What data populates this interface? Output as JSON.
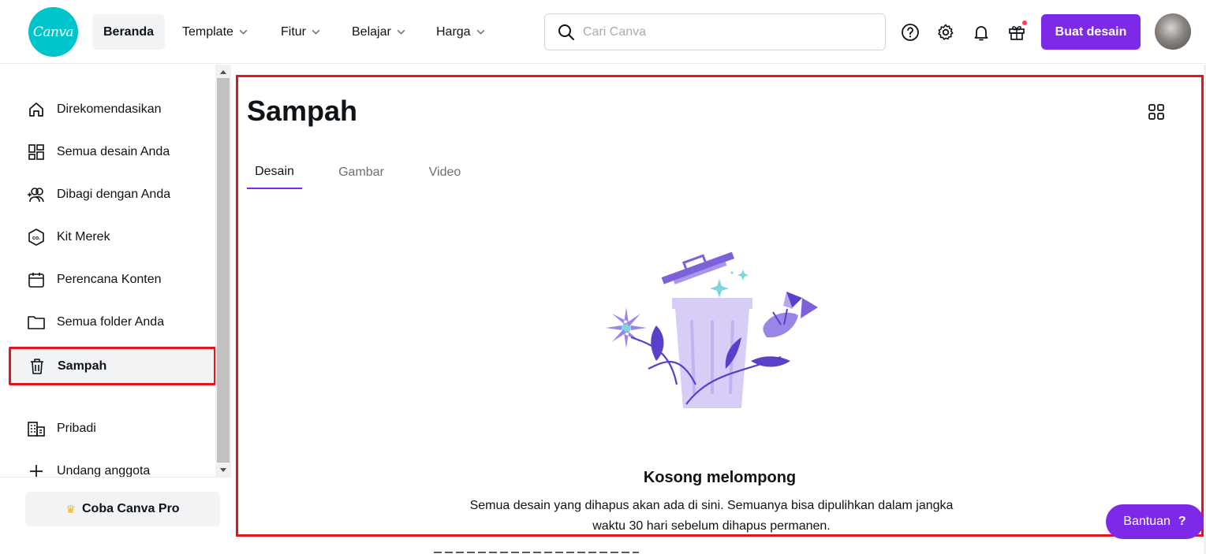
{
  "header": {
    "logo_text": "Canva",
    "nav": [
      {
        "label": "Beranda",
        "active": true
      },
      {
        "label": "Template"
      },
      {
        "label": "Fitur"
      },
      {
        "label": "Belajar"
      },
      {
        "label": "Harga"
      }
    ],
    "search_placeholder": "Cari Canva",
    "create_label": "Buat desain"
  },
  "sidebar": {
    "items": [
      {
        "label": "Direkomendasikan",
        "icon": "home-icon"
      },
      {
        "label": "Semua desain Anda",
        "icon": "designs-grid-icon"
      },
      {
        "label": "Dibagi dengan Anda",
        "icon": "shared-people-icon"
      },
      {
        "label": "Kit Merek",
        "icon": "brand-kit-icon"
      },
      {
        "label": "Perencana Konten",
        "icon": "calendar-icon"
      },
      {
        "label": "Semua folder Anda",
        "icon": "folder-icon"
      },
      {
        "label": "Sampah",
        "icon": "trash-icon",
        "active": true
      },
      {
        "label": "Pribadi",
        "icon": "building-icon"
      },
      {
        "label": "Undang anggota",
        "icon": "plus-icon"
      }
    ],
    "pro_label": "Coba Canva Pro"
  },
  "main": {
    "title": "Sampah",
    "tabs": [
      {
        "label": "Desain",
        "active": true
      },
      {
        "label": "Gambar"
      },
      {
        "label": "Video"
      }
    ],
    "empty_title": "Kosong melompong",
    "empty_line1": "Semua desain yang dihapus akan ada di sini. Semuanya bisa dipulihkan dalam jangka",
    "empty_line2": "waktu 30 hari sebelum dihapus permanen."
  },
  "help_label": "Bantuan",
  "colors": {
    "accent": "#7d2ae8",
    "logo": "#00c4cc",
    "highlight_border": "#e4141c"
  }
}
